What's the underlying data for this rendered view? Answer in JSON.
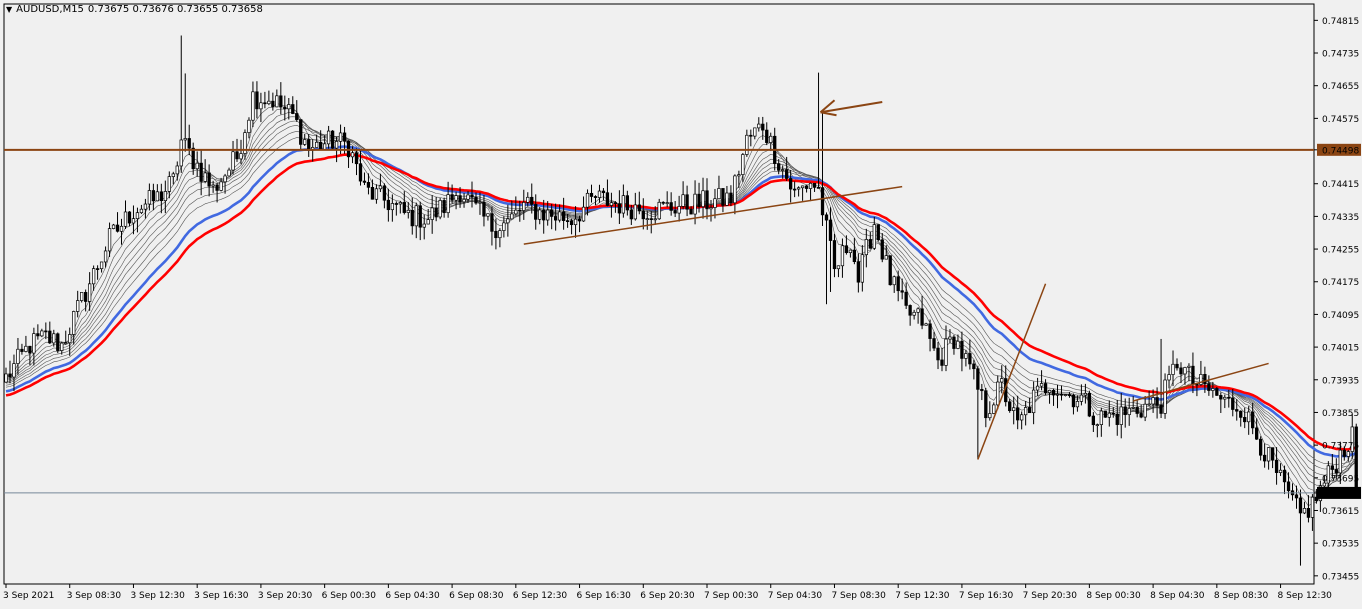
{
  "header": {
    "symbol_tf": "AUDUSD,M15",
    "ohlc": "0.73675 0.73676 0.73655 0.73658",
    "collapse_icon": "triangle-down-icon"
  },
  "colors": {
    "background": "#f0f0f0",
    "bull_body": "#ffffff",
    "bear_body": "#000000",
    "ema_blue": "#4169e1",
    "ema_red": "#ff0000",
    "ribbon": "#555555",
    "trendline": "#8b4513",
    "hline_resistance": "#8b4513",
    "bid_line": "#778899",
    "price_tag_resistance_bg": "#8b4513",
    "price_tag_bid_bg": "#000000"
  },
  "chart_data": {
    "type": "candlestick",
    "symbol": "AUDUSD",
    "timeframe": "M15",
    "ylim": [
      0.73435,
      0.74855
    ],
    "y_ticks": [
      "0.74815",
      "0.74735",
      "0.74655",
      "0.74575",
      "0.74498",
      "0.74415",
      "0.74335",
      "0.74255",
      "0.74175",
      "0.74095",
      "0.74015",
      "0.73935",
      "0.73855",
      "0.73775",
      "0.73695",
      "0.73658",
      "0.73615",
      "0.73535",
      "0.73455"
    ],
    "x_ticks": [
      "3 Sep 2021",
      "3 Sep 08:30",
      "3 Sep 12:30",
      "3 Sep 16:30",
      "3 Sep 20:30",
      "6 Sep 00:30",
      "6 Sep 04:30",
      "6 Sep 08:30",
      "6 Sep 12:30",
      "6 Sep 16:30",
      "6 Sep 20:30",
      "7 Sep 00:30",
      "7 Sep 04:30",
      "7 Sep 08:30",
      "7 Sep 12:30",
      "7 Sep 16:30",
      "7 Sep 20:30",
      "8 Sep 00:30",
      "8 Sep 04:30",
      "8 Sep 08:30",
      "8 Sep 12:30"
    ],
    "bars_per_tick": 16,
    "horizontal_line": 0.74498,
    "bid_line": 0.73658,
    "price_path": [
      [
        0,
        0.7394
      ],
      [
        6,
        0.7402
      ],
      [
        10,
        0.7404
      ],
      [
        14,
        0.7402
      ],
      [
        20,
        0.7415
      ],
      [
        26,
        0.7428
      ],
      [
        32,
        0.7435
      ],
      [
        38,
        0.7438
      ],
      [
        42,
        0.7442
      ],
      [
        44,
        0.7452
      ],
      [
        48,
        0.7446
      ],
      [
        52,
        0.744
      ],
      [
        55,
        0.7444
      ],
      [
        58,
        0.7448
      ],
      [
        62,
        0.7463
      ],
      [
        67,
        0.7462
      ],
      [
        72,
        0.7458
      ],
      [
        76,
        0.745
      ],
      [
        82,
        0.7452
      ],
      [
        86,
        0.7451
      ],
      [
        90,
        0.744
      ],
      [
        96,
        0.7437
      ],
      [
        100,
        0.7434
      ],
      [
        106,
        0.7433
      ],
      [
        110,
        0.7436
      ],
      [
        114,
        0.744
      ],
      [
        118,
        0.7435
      ],
      [
        122,
        0.7431
      ],
      [
        126,
        0.7432
      ],
      [
        130,
        0.7436
      ],
      [
        136,
        0.7434
      ],
      [
        142,
        0.7433
      ],
      [
        148,
        0.7438
      ],
      [
        156,
        0.7436
      ],
      [
        162,
        0.7435
      ],
      [
        168,
        0.7436
      ],
      [
        176,
        0.7437
      ],
      [
        182,
        0.7438
      ],
      [
        186,
        0.7452
      ],
      [
        190,
        0.7456
      ],
      [
        194,
        0.7447
      ],
      [
        198,
        0.7439
      ],
      [
        202,
        0.7442
      ],
      [
        204,
        0.744
      ],
      [
        206,
        0.743
      ],
      [
        208,
        0.742
      ],
      [
        212,
        0.7428
      ],
      [
        214,
        0.7418
      ],
      [
        216,
        0.7425
      ],
      [
        218,
        0.7432
      ],
      [
        222,
        0.7418
      ],
      [
        226,
        0.741
      ],
      [
        230,
        0.7408
      ],
      [
        234,
        0.7398
      ],
      [
        238,
        0.7404
      ],
      [
        242,
        0.7396
      ],
      [
        246,
        0.7386
      ],
      [
        250,
        0.7392
      ],
      [
        254,
        0.7382
      ],
      [
        258,
        0.7389
      ],
      [
        262,
        0.7393
      ],
      [
        266,
        0.739
      ],
      [
        270,
        0.7389
      ],
      [
        274,
        0.7384
      ],
      [
        280,
        0.7385
      ],
      [
        286,
        0.7387
      ],
      [
        290,
        0.7388
      ],
      [
        294,
        0.7398
      ],
      [
        298,
        0.7393
      ],
      [
        302,
        0.7391
      ],
      [
        306,
        0.7388
      ],
      [
        310,
        0.7387
      ],
      [
        314,
        0.738
      ],
      [
        318,
        0.7372
      ],
      [
        322,
        0.7365
      ],
      [
        325,
        0.736
      ],
      [
        328,
        0.7363
      ],
      [
        332,
        0.737
      ],
      [
        336,
        0.7377
      ],
      [
        339,
        0.738
      ]
    ],
    "annotations": [
      {
        "type": "trendline",
        "p1": [
          130,
          0.74267
        ],
        "p2": [
          225,
          0.74408
        ]
      },
      {
        "type": "trendline",
        "p1": [
          244,
          0.7374
        ],
        "p2": [
          261,
          0.7417
        ]
      },
      {
        "type": "trendline",
        "p1": [
          283,
          0.73883
        ],
        "p2": [
          317,
          0.73975
        ]
      },
      {
        "type": "arrow",
        "tip": [
          204.5,
          0.7459
        ],
        "from": [
          220,
          0.74615
        ]
      }
    ]
  }
}
